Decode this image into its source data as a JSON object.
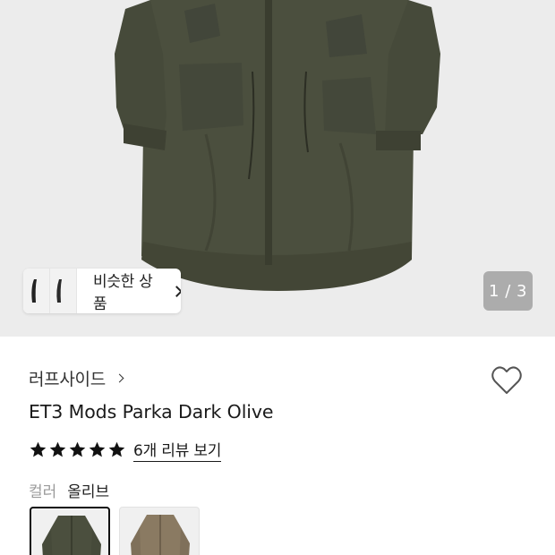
{
  "hero": {
    "image_desc": "dark olive mods parka",
    "similar_products_label": "비슷한 상품",
    "pager_text": "1 / 3"
  },
  "product": {
    "brand": "러프사이드",
    "title": "ET3 Mods Parka Dark Olive",
    "rating_stars": 5,
    "review_link": "6개 리뷰 보기",
    "wishlisted": false
  },
  "options": {
    "color_label": "컬러",
    "color_value": "올리브",
    "swatches": [
      {
        "name": "olive",
        "color": "#4b4f3e",
        "selected": true
      },
      {
        "name": "beige",
        "color": "#8a7a62",
        "selected": false
      }
    ]
  },
  "colors": {
    "coat": "#4b4f3e",
    "coat_shadow": "#3a3d2f",
    "hero_bg": "#ececec",
    "star": "#111111"
  }
}
